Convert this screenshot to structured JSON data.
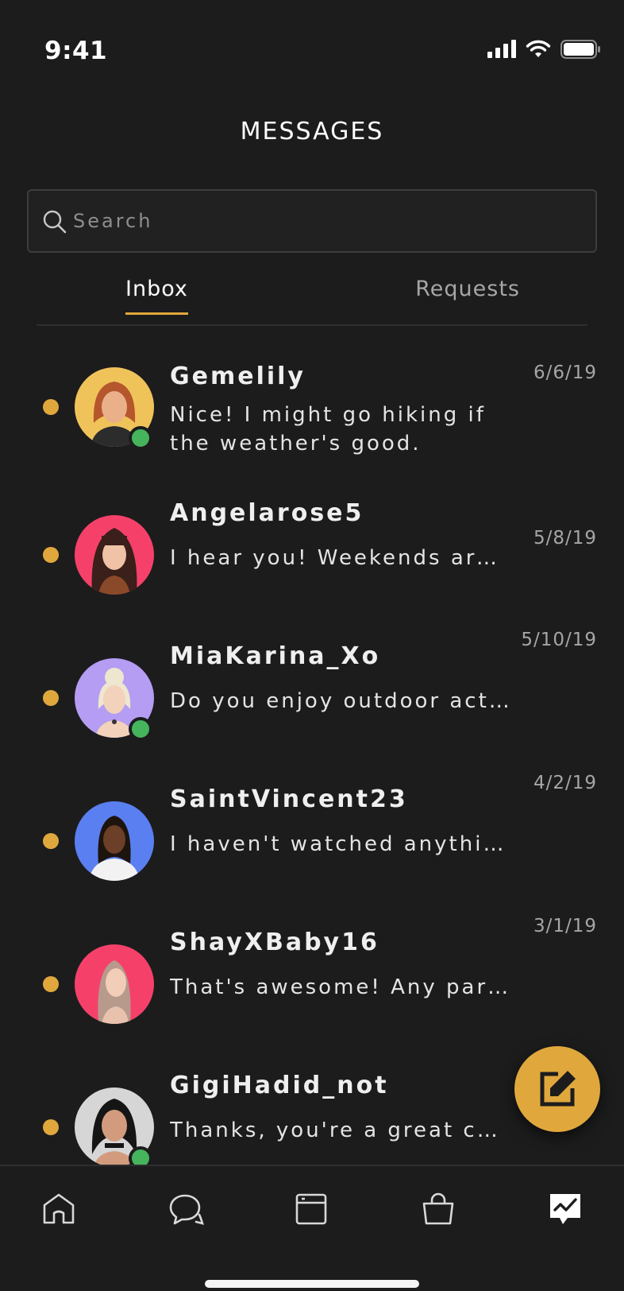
{
  "status_bar": {
    "time": "9:41"
  },
  "header": {
    "title": "MESSAGES"
  },
  "search": {
    "placeholder": "Search",
    "value": ""
  },
  "tabs": [
    {
      "label": "Inbox",
      "active": true
    },
    {
      "label": "Requests",
      "active": false
    }
  ],
  "conversations": [
    {
      "name": "Gemelily",
      "message": "Nice! I might go hiking if the weather's good.",
      "date": "6/6/19",
      "unread": true,
      "online": true,
      "avatar_bg": "#f0c35a"
    },
    {
      "name": "Angelarose5",
      "message": "I hear you! Weekends are…",
      "date": "5/8/19",
      "unread": true,
      "online": false,
      "avatar_bg": "#f5416a"
    },
    {
      "name": "MiaKarina_Xo",
      "message": "Do you enjoy outdoor act…",
      "date": "5/10/19",
      "unread": true,
      "online": true,
      "avatar_bg": "#b49df2"
    },
    {
      "name": "SaintVincent23",
      "message": "I haven't watched anythin…",
      "date": "4/2/19",
      "unread": true,
      "online": false,
      "avatar_bg": "#5a7ff0"
    },
    {
      "name": "ShayXBaby16",
      "message": "That's awesome! Any par…",
      "date": "3/1/19",
      "unread": true,
      "online": false,
      "avatar_bg": "#f5416a"
    },
    {
      "name": "GigiHadid_not",
      "message": "Thanks, you're a great ch…",
      "date": "",
      "unread": true,
      "online": true,
      "avatar_bg": "#d6d6d6"
    }
  ],
  "compose_button": {
    "icon": "compose-icon"
  },
  "bottom_nav": [
    {
      "icon": "home-icon"
    },
    {
      "icon": "chat-icon"
    },
    {
      "icon": "feed-icon"
    },
    {
      "icon": "shop-icon"
    },
    {
      "icon": "messages-icon",
      "active": true
    }
  ],
  "colors": {
    "accent": "#e0a83c",
    "online": "#45b45d",
    "background": "#1c1c1d"
  }
}
